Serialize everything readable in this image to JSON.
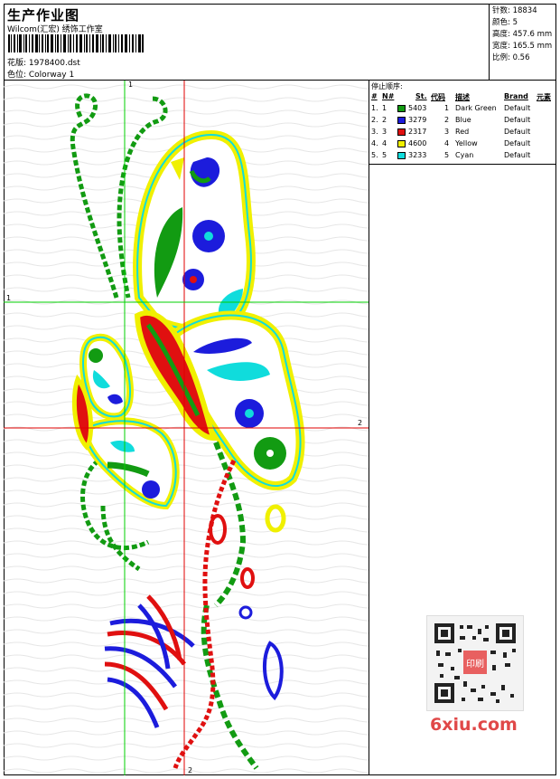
{
  "header": {
    "title": "生产作业图",
    "studio": "Wilcom(汇宏) 绣饰工作室",
    "pattern_label": "花版: 1978400.dst",
    "colorway_label": "色位: Colorway 1"
  },
  "stats": {
    "stitches": "针数: 18834",
    "colors": "颜色: 5",
    "height": "高度: 457.6 mm",
    "width": "宽度: 165.5 mm",
    "scale": "比例: 0.56"
  },
  "guides": {
    "v1": "1",
    "v2": "2",
    "h1": "1",
    "h2": "2"
  },
  "color_table": {
    "title": "停止顺序:",
    "headers": [
      "#",
      "N#",
      "St.",
      "代码",
      "描述",
      "Brand",
      "元素"
    ],
    "rows": [
      {
        "idx": "1.",
        "n": "1",
        "color": "#129b12",
        "st": "5403",
        "code": "1",
        "desc": "Dark Green",
        "brand": "Default"
      },
      {
        "idx": "2.",
        "n": "2",
        "color": "#1c1cdc",
        "st": "3279",
        "code": "2",
        "desc": "Blue",
        "brand": "Default"
      },
      {
        "idx": "3.",
        "n": "3",
        "color": "#e01010",
        "st": "2317",
        "code": "3",
        "desc": "Red",
        "brand": "Default"
      },
      {
        "idx": "4.",
        "n": "4",
        "color": "#f0f000",
        "st": "4600",
        "code": "4",
        "desc": "Yellow",
        "brand": "Default"
      },
      {
        "idx": "5.",
        "n": "5",
        "color": "#10dcdc",
        "st": "3233",
        "code": "5",
        "desc": "Cyan",
        "brand": "Default"
      }
    ]
  },
  "watermark": "6xiu.com",
  "qr_stamp": "印刷"
}
